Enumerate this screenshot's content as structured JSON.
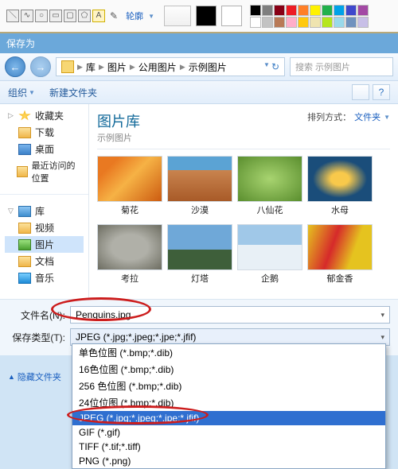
{
  "ribbon": {
    "outline_label": "轮廓",
    "colors_primary": "#000000",
    "colors_secondary": "#ffffff",
    "palette": [
      "#000000",
      "#7f7f7f",
      "#880015",
      "#ed1c24",
      "#ff7f27",
      "#fff200",
      "#22b14c",
      "#00a2e8",
      "#3f48cc",
      "#a349a4",
      "#ffffff",
      "#c3c3c3",
      "#b97a57",
      "#ffaec9",
      "#ffc90e",
      "#efe4b0",
      "#b5e61d",
      "#99d9ea",
      "#7092be",
      "#c8bfe7"
    ]
  },
  "titlebar": {
    "text": "保存为"
  },
  "nav": {
    "breadcrumb": [
      "库",
      "图片",
      "公用图片",
      "示例图片"
    ],
    "search_placeholder": "搜索 示例图片"
  },
  "toolbar": {
    "organize": "组织",
    "new_folder": "新建文件夹"
  },
  "sidebar": {
    "favorites": "收藏夹",
    "downloads": "下载",
    "desktop": "桌面",
    "recent": "最近访问的位置",
    "library": "库",
    "video": "视频",
    "pictures": "图片",
    "documents": "文档",
    "music": "音乐"
  },
  "content": {
    "title": "图片库",
    "subtitle": "示例图片",
    "sort_label": "排列方式：",
    "sort_value": "文件夹",
    "thumbs": [
      {
        "label": "菊花",
        "bg": "linear-gradient(135deg,#e97921 20%,#f6b245 50%,#cc5b11)"
      },
      {
        "label": "沙漠",
        "bg": "linear-gradient(#5ba3d4 30%,#c9844f 30%,#a85a28)"
      },
      {
        "label": "八仙花",
        "bg": "radial-gradient(#a8d470,#5a8e2e)"
      },
      {
        "label": "水母",
        "bg": "radial-gradient(#f8c94b 20%,#1a4d7a 60%)"
      },
      {
        "label": "考拉",
        "bg": "radial-gradient(#b0b0a8 40%,#6c6c60)"
      },
      {
        "label": "灯塔",
        "bg": "linear-gradient(#6fa8d8 55%,#3e5f3a 55%)"
      },
      {
        "label": "企鹅",
        "bg": "linear-gradient(#a0c8e8 45%,#e8f0f6 45%)"
      },
      {
        "label": "郁金香",
        "bg": "linear-gradient(110deg,#e5c31f,#d62a2a 40%,#e5c31f 70%)"
      }
    ]
  },
  "form": {
    "filename_label": "文件名(N):",
    "filename_value": "Penguins.jpg",
    "filetype_label": "保存类型(T):",
    "filetype_value": "JPEG (*.jpg;*.jpeg;*.jpe;*.jfif)",
    "hide_folders": "隐藏文件夹"
  },
  "dropdown": {
    "items": [
      "单色位图 (*.bmp;*.dib)",
      "16色位图 (*.bmp;*.dib)",
      "256 色位图 (*.bmp;*.dib)",
      "24位位图 (*.bmp;*.dib)",
      "JPEG (*.jpg;*.jpeg;*.jpe;*.jfif)",
      "GIF (*.gif)",
      "TIFF (*.tif;*.tiff)",
      "PNG (*.png)"
    ],
    "highlight_index": 4
  }
}
